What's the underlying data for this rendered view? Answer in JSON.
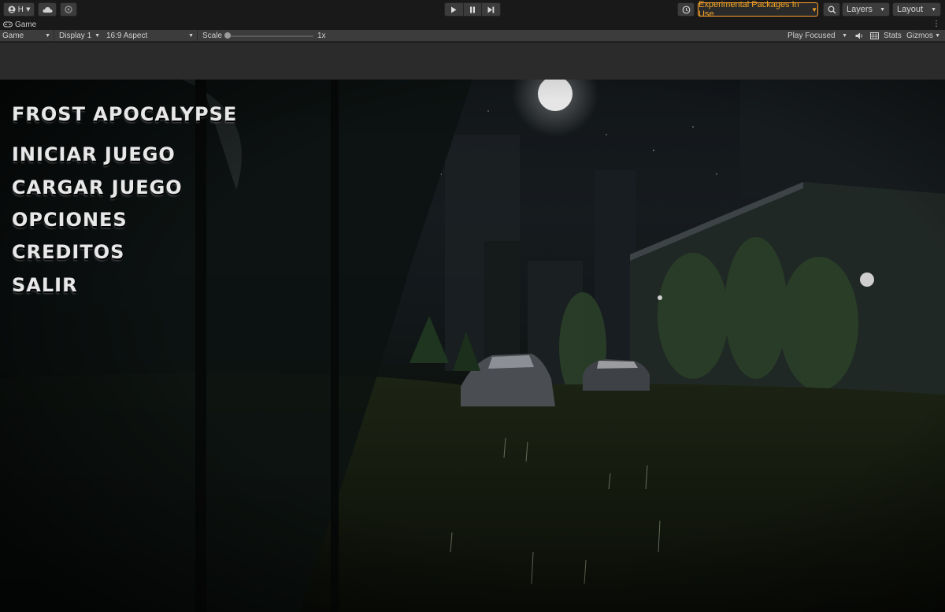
{
  "toolbar": {
    "account_label": "H",
    "experimental_label": "Experimental Packages In Use",
    "layers_label": "Layers",
    "layout_label": "Layout",
    "icons": [
      "account-icon",
      "cloud-icon",
      "collab-icon",
      "play-icon",
      "pause-icon",
      "step-icon",
      "history-icon",
      "search-icon"
    ]
  },
  "tabs": {
    "game_tab_label": "Game",
    "menu_glyph": "⋮"
  },
  "game_bar": {
    "mode_dropdown": "Game",
    "display_dropdown": "Display 1",
    "aspect_dropdown": "16:9 Aspect",
    "scale_label": "Scale",
    "scale_value": "1x",
    "play_mode_dropdown": "Play Focused",
    "stats_label": "Stats",
    "gizmos_label": "Gizmos",
    "scale_slider_fraction": 0.0
  },
  "game": {
    "title": "FROST APOCALYPSE",
    "menu_items": [
      "INICIAR JUEGO",
      "CARGAR JUEGO",
      "OPCIONES",
      "CREDITOS",
      "SALIR"
    ]
  },
  "colors": {
    "editor_bg": "#191919",
    "toolbar_button": "#3c3c3c",
    "experimental_accent": "#f5a623",
    "menu_text": "#e8e8e8"
  }
}
